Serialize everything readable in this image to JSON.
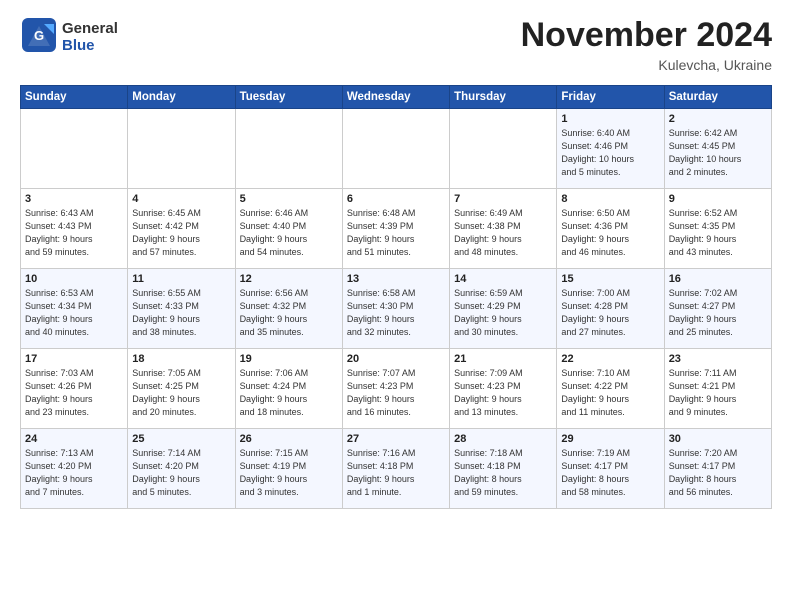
{
  "header": {
    "logo_general": "General",
    "logo_blue": "Blue",
    "month_title": "November 2024",
    "subtitle": "Kulevcha, Ukraine"
  },
  "days_of_week": [
    "Sunday",
    "Monday",
    "Tuesday",
    "Wednesday",
    "Thursday",
    "Friday",
    "Saturday"
  ],
  "weeks": [
    [
      {
        "day": "",
        "info": ""
      },
      {
        "day": "",
        "info": ""
      },
      {
        "day": "",
        "info": ""
      },
      {
        "day": "",
        "info": ""
      },
      {
        "day": "",
        "info": ""
      },
      {
        "day": "1",
        "info": "Sunrise: 6:40 AM\nSunset: 4:46 PM\nDaylight: 10 hours\nand 5 minutes."
      },
      {
        "day": "2",
        "info": "Sunrise: 6:42 AM\nSunset: 4:45 PM\nDaylight: 10 hours\nand 2 minutes."
      }
    ],
    [
      {
        "day": "3",
        "info": "Sunrise: 6:43 AM\nSunset: 4:43 PM\nDaylight: 9 hours\nand 59 minutes."
      },
      {
        "day": "4",
        "info": "Sunrise: 6:45 AM\nSunset: 4:42 PM\nDaylight: 9 hours\nand 57 minutes."
      },
      {
        "day": "5",
        "info": "Sunrise: 6:46 AM\nSunset: 4:40 PM\nDaylight: 9 hours\nand 54 minutes."
      },
      {
        "day": "6",
        "info": "Sunrise: 6:48 AM\nSunset: 4:39 PM\nDaylight: 9 hours\nand 51 minutes."
      },
      {
        "day": "7",
        "info": "Sunrise: 6:49 AM\nSunset: 4:38 PM\nDaylight: 9 hours\nand 48 minutes."
      },
      {
        "day": "8",
        "info": "Sunrise: 6:50 AM\nSunset: 4:36 PM\nDaylight: 9 hours\nand 46 minutes."
      },
      {
        "day": "9",
        "info": "Sunrise: 6:52 AM\nSunset: 4:35 PM\nDaylight: 9 hours\nand 43 minutes."
      }
    ],
    [
      {
        "day": "10",
        "info": "Sunrise: 6:53 AM\nSunset: 4:34 PM\nDaylight: 9 hours\nand 40 minutes."
      },
      {
        "day": "11",
        "info": "Sunrise: 6:55 AM\nSunset: 4:33 PM\nDaylight: 9 hours\nand 38 minutes."
      },
      {
        "day": "12",
        "info": "Sunrise: 6:56 AM\nSunset: 4:32 PM\nDaylight: 9 hours\nand 35 minutes."
      },
      {
        "day": "13",
        "info": "Sunrise: 6:58 AM\nSunset: 4:30 PM\nDaylight: 9 hours\nand 32 minutes."
      },
      {
        "day": "14",
        "info": "Sunrise: 6:59 AM\nSunset: 4:29 PM\nDaylight: 9 hours\nand 30 minutes."
      },
      {
        "day": "15",
        "info": "Sunrise: 7:00 AM\nSunset: 4:28 PM\nDaylight: 9 hours\nand 27 minutes."
      },
      {
        "day": "16",
        "info": "Sunrise: 7:02 AM\nSunset: 4:27 PM\nDaylight: 9 hours\nand 25 minutes."
      }
    ],
    [
      {
        "day": "17",
        "info": "Sunrise: 7:03 AM\nSunset: 4:26 PM\nDaylight: 9 hours\nand 23 minutes."
      },
      {
        "day": "18",
        "info": "Sunrise: 7:05 AM\nSunset: 4:25 PM\nDaylight: 9 hours\nand 20 minutes."
      },
      {
        "day": "19",
        "info": "Sunrise: 7:06 AM\nSunset: 4:24 PM\nDaylight: 9 hours\nand 18 minutes."
      },
      {
        "day": "20",
        "info": "Sunrise: 7:07 AM\nSunset: 4:23 PM\nDaylight: 9 hours\nand 16 minutes."
      },
      {
        "day": "21",
        "info": "Sunrise: 7:09 AM\nSunset: 4:23 PM\nDaylight: 9 hours\nand 13 minutes."
      },
      {
        "day": "22",
        "info": "Sunrise: 7:10 AM\nSunset: 4:22 PM\nDaylight: 9 hours\nand 11 minutes."
      },
      {
        "day": "23",
        "info": "Sunrise: 7:11 AM\nSunset: 4:21 PM\nDaylight: 9 hours\nand 9 minutes."
      }
    ],
    [
      {
        "day": "24",
        "info": "Sunrise: 7:13 AM\nSunset: 4:20 PM\nDaylight: 9 hours\nand 7 minutes."
      },
      {
        "day": "25",
        "info": "Sunrise: 7:14 AM\nSunset: 4:20 PM\nDaylight: 9 hours\nand 5 minutes."
      },
      {
        "day": "26",
        "info": "Sunrise: 7:15 AM\nSunset: 4:19 PM\nDaylight: 9 hours\nand 3 minutes."
      },
      {
        "day": "27",
        "info": "Sunrise: 7:16 AM\nSunset: 4:18 PM\nDaylight: 9 hours\nand 1 minute."
      },
      {
        "day": "28",
        "info": "Sunrise: 7:18 AM\nSunset: 4:18 PM\nDaylight: 8 hours\nand 59 minutes."
      },
      {
        "day": "29",
        "info": "Sunrise: 7:19 AM\nSunset: 4:17 PM\nDaylight: 8 hours\nand 58 minutes."
      },
      {
        "day": "30",
        "info": "Sunrise: 7:20 AM\nSunset: 4:17 PM\nDaylight: 8 hours\nand 56 minutes."
      }
    ]
  ]
}
